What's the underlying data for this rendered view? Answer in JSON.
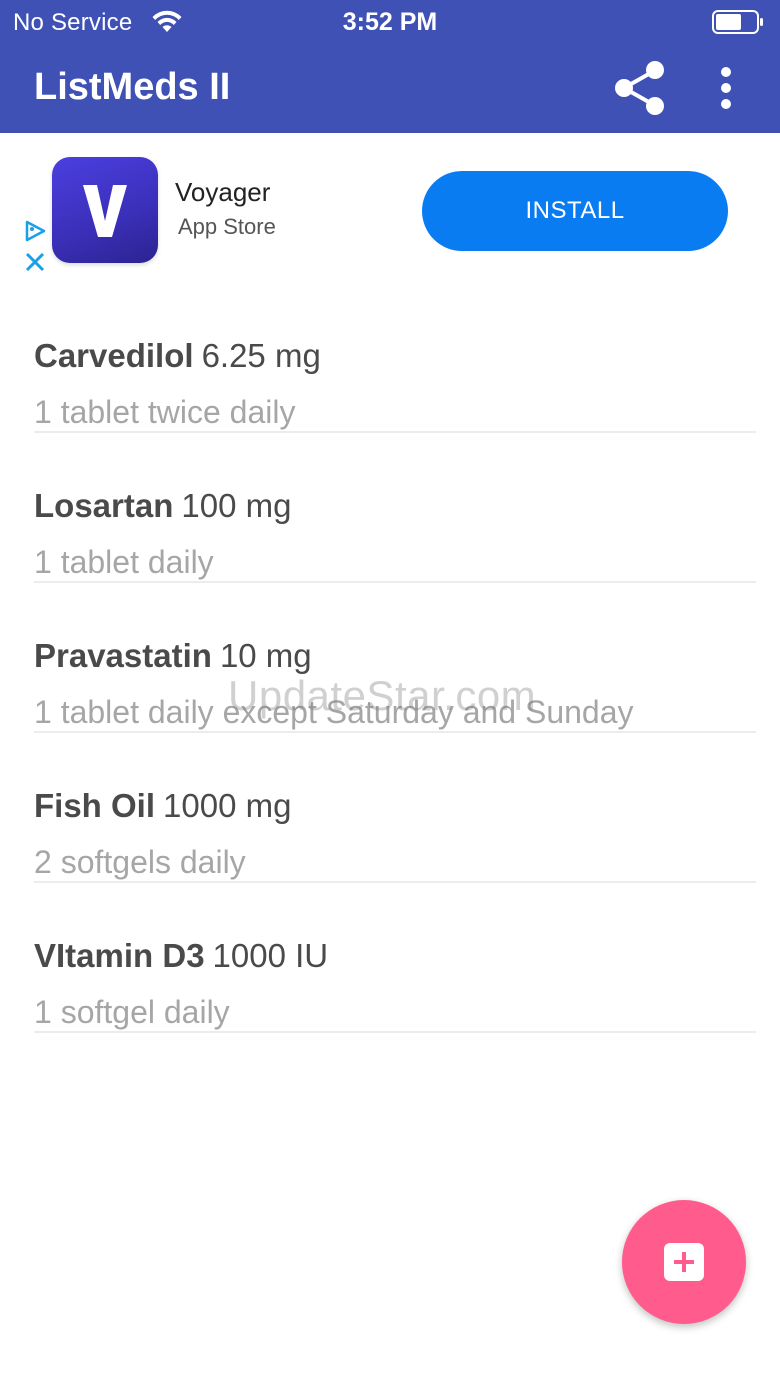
{
  "status_bar": {
    "carrier": "No Service",
    "time": "3:52 PM",
    "wifi_icon": "wifi-icon",
    "battery_icon": "battery-icon"
  },
  "app_bar": {
    "title": "ListMeds II",
    "share_icon": "share-icon",
    "more_icon": "more-vert-icon",
    "background_color": "#3F51B5"
  },
  "ad": {
    "app_name": "Voyager",
    "store": "App Store",
    "install_label": "INSTALL",
    "icon_letter": "V",
    "adchoices_icon": "adchoices-icon",
    "close_icon": "close-icon",
    "button_color": "#0A7CF2"
  },
  "medications": [
    {
      "name": "Carvedilol",
      "dose": "6.25 mg",
      "schedule": "1 tablet twice daily"
    },
    {
      "name": "Losartan",
      "dose": "100 mg",
      "schedule": "1 tablet daily"
    },
    {
      "name": "Pravastatin",
      "dose": "10 mg",
      "schedule": "1 tablet daily except Saturday and Sunday"
    },
    {
      "name": "Fish Oil",
      "dose": "1000 mg",
      "schedule": "2 softgels daily"
    },
    {
      "name": "VItamin D3",
      "dose": "1000 IU",
      "schedule": "1 softgel daily"
    }
  ],
  "watermark": "UpdateStar.com",
  "fab": {
    "icon": "add-box-icon",
    "color": "#FF5C8D"
  }
}
